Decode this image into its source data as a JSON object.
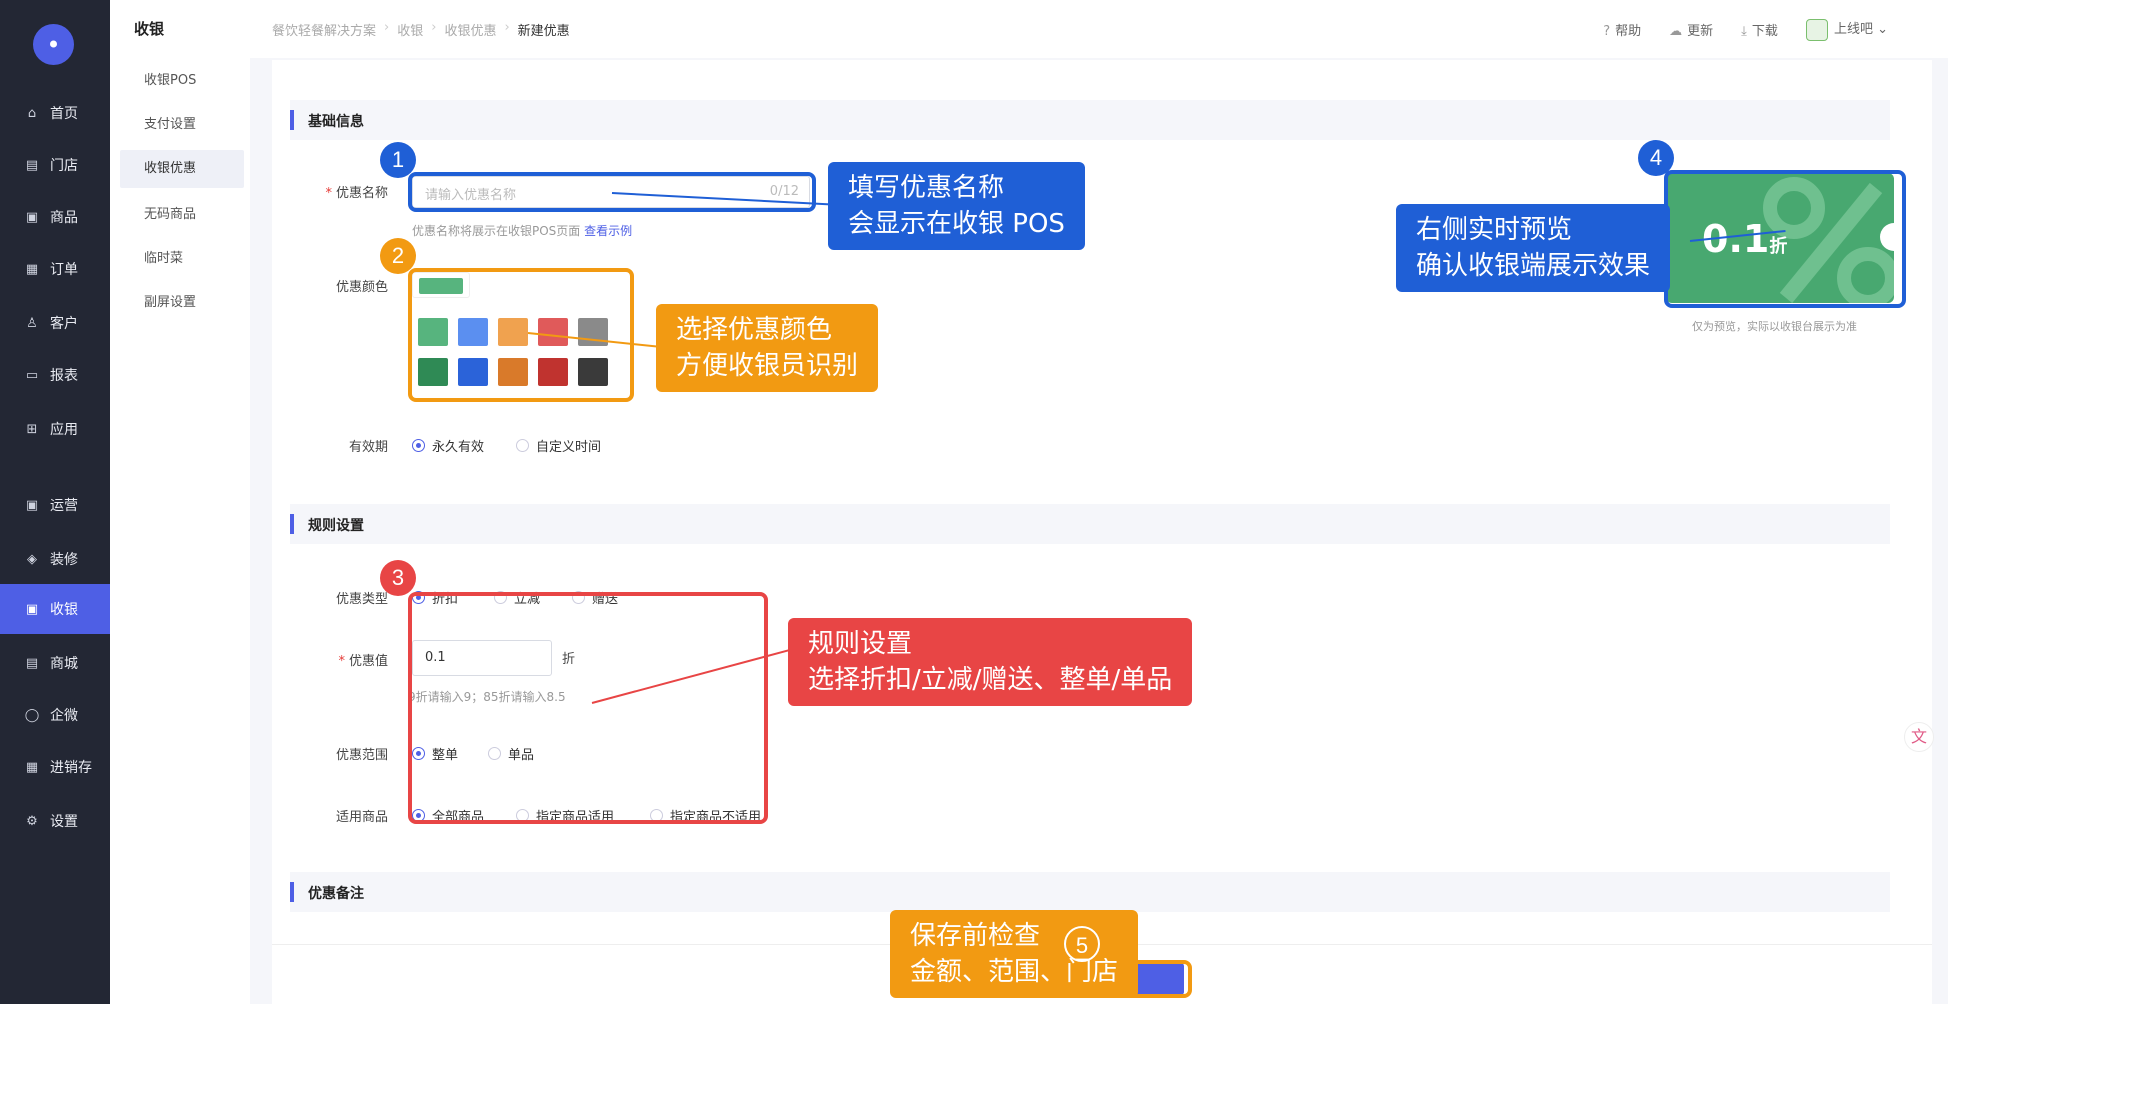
{
  "nav": {
    "items": [
      {
        "label": "首页",
        "icon": "home-icon",
        "glyph": "⌂"
      },
      {
        "label": "门店",
        "icon": "store-icon",
        "glyph": "▤"
      },
      {
        "label": "商品",
        "icon": "goods-icon",
        "glyph": "▣"
      },
      {
        "label": "订单",
        "icon": "order-icon",
        "glyph": "▦"
      },
      {
        "label": "客户",
        "icon": "user-icon",
        "glyph": "♙"
      },
      {
        "label": "报表",
        "icon": "report-icon",
        "glyph": "▭"
      },
      {
        "label": "应用",
        "icon": "apps-icon",
        "glyph": "⊞"
      },
      {
        "label": "运营",
        "icon": "operation-icon",
        "glyph": "▣"
      },
      {
        "label": "装修",
        "icon": "decorate-icon",
        "glyph": "◈"
      },
      {
        "label": "收银",
        "icon": "cashier-icon",
        "glyph": "▣"
      },
      {
        "label": "商城",
        "icon": "mall-icon",
        "glyph": "▤"
      },
      {
        "label": "企微",
        "icon": "wecom-icon",
        "glyph": "◯"
      },
      {
        "label": "进销存",
        "icon": "inventory-icon",
        "glyph": "▦"
      },
      {
        "label": "设置",
        "icon": "settings-icon",
        "glyph": "⚙"
      }
    ],
    "active_label": "收银"
  },
  "subnav": {
    "title": "收银",
    "items": [
      "收银POS",
      "支付设置",
      "收银优惠",
      "无码商品",
      "临时菜",
      "副屏设置"
    ],
    "active": "收银优惠"
  },
  "topbar": {
    "breadcrumb": [
      "餐饮轻餐解决方案",
      "收银",
      "收银优惠",
      "新建优惠"
    ],
    "help": "帮助",
    "update": "更新",
    "download": "下载",
    "shop": "上线吧"
  },
  "form": {
    "basic_title": "基础信息",
    "name_label": "优惠名称",
    "name_placeholder": "请输入优惠名称",
    "name_counter": "0/12",
    "name_hint": "优惠名称将展示在收银POS页面",
    "name_hint_link": "查看示例",
    "color_label": "优惠颜色",
    "colors_row1": [
      "#57b47e",
      "#5b8ff0",
      "#f0a24f",
      "#e05a5a",
      "#8a8a8a"
    ],
    "colors_row2": [
      "#2f8a55",
      "#2b63d9",
      "#d97a2a",
      "#c0332f",
      "#3a3a3a"
    ],
    "selected_color": "#57b47e",
    "validity_label": "有效期",
    "validity_options": [
      "永久有效",
      "自定义时间"
    ],
    "rules_title": "规则设置",
    "type_label": "优惠类型",
    "type_options": [
      "折扣",
      "立减",
      "赠送"
    ],
    "value_label": "优惠值",
    "value": "0.1",
    "value_unit": "折",
    "value_hint": "9折请输入9；85折请输入8.5",
    "scope_label": "优惠范围",
    "scope_options": [
      "整单",
      "单品"
    ],
    "goods_label": "适用商品",
    "goods_options": [
      "全部商品",
      "指定商品适用",
      "指定商品不适用"
    ],
    "note_title": "优惠备注"
  },
  "preview": {
    "value": "0.1",
    "unit": "折",
    "note": "仅为预览，实际以收银台展示为准"
  },
  "annotations": {
    "n1": "1",
    "n2": "2",
    "n3": "3",
    "n4": "4",
    "n5": "5",
    "c1_line1": "填写优惠名称",
    "c1_line2": "会显示在收银 POS",
    "c2_line1": "选择优惠颜色",
    "c2_line2": "方便收银员识别",
    "c3_line1": "规则设置",
    "c3_line2": "选择折扣/立减/赠送、整单/单品",
    "c4_line1": "右侧实时预览",
    "c4_line2": "确认收银端展示效果",
    "c5_line1": "保存前检查",
    "c5_line2": "金额、范围、门店",
    "blue": "#1f5fd6",
    "orange": "#f29a12",
    "red": "#e84545"
  }
}
